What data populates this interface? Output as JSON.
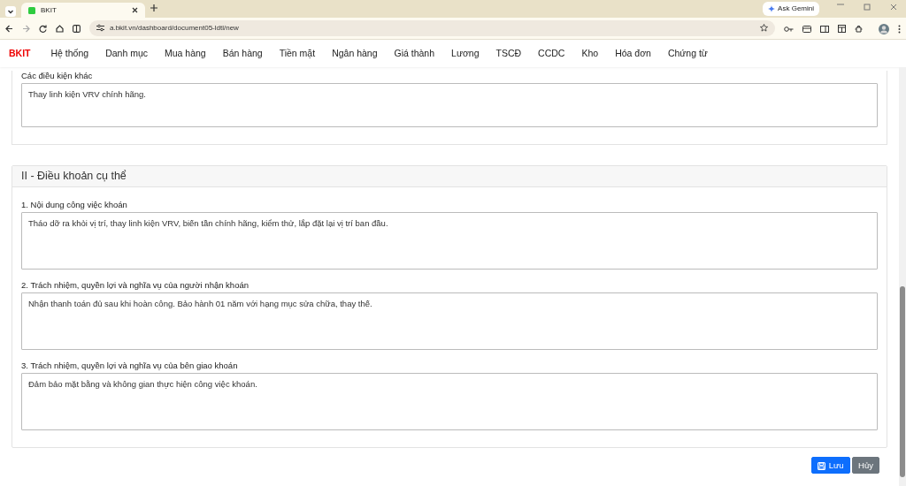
{
  "browser": {
    "tab_title": "BKIT",
    "url": "a.bkit.vn/dashboard/document05-ldtl/new",
    "ask_button": "Ask Gemini"
  },
  "navbar": {
    "brand": "BKIT",
    "items": [
      "Hệ thống",
      "Danh mục",
      "Mua hàng",
      "Bán hàng",
      "Tiền mặt",
      "Ngân hàng",
      "Giá thành",
      "Lương",
      "TSCĐ",
      "CCDC",
      "Kho",
      "Hóa đơn",
      "Chứng từ"
    ]
  },
  "sections": [
    {
      "fields": [
        {
          "label": "Các điều kiện khác",
          "value": "Thay linh kiện VRV chính hãng."
        }
      ]
    },
    {
      "title": "II - Điều khoản cụ thể",
      "fields": [
        {
          "label": "1. Nội dung công việc khoán",
          "value": "Tháo dỡ ra khỏi vị trí, thay linh kiện VRV, biến tần chính hãng, kiểm thử, lắp đặt lại vị trí ban đầu."
        },
        {
          "label": "2. Trách nhiệm, quyền lợi và nghĩa vụ của người nhận khoán",
          "value": "Nhận thanh toán đủ sau khi hoàn công. Bảo hành 01 năm với hạng mục sửa chữa, thay thế."
        },
        {
          "label": "3. Trách nhiệm, quyền lợi và nghĩa vụ của bên giao khoán",
          "value": "Đảm bảo mặt bằng và không gian thực hiện công việc khoán."
        }
      ]
    }
  ],
  "buttons": [
    {
      "label": "Lưu",
      "kind": "primary"
    },
    {
      "label": "Hủy",
      "kind": "secondary"
    }
  ]
}
